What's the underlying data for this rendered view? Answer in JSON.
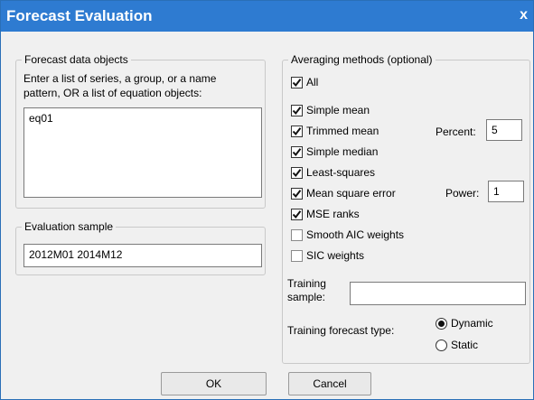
{
  "window": {
    "title": "Forecast Evaluation",
    "close_label": "x"
  },
  "forecast_objects": {
    "legend": "Forecast data objects",
    "instruction_line1": "Enter a list of series, a group, or a name",
    "instruction_line2": "pattern, OR a list of equation objects:",
    "value": "eq01"
  },
  "evaluation_sample": {
    "legend": "Evaluation sample",
    "value": "2012M01 2014M12"
  },
  "averaging": {
    "legend": "Averaging methods (optional)",
    "all": {
      "label": "All",
      "checked": true
    },
    "methods": [
      {
        "label": "Simple mean",
        "checked": true
      },
      {
        "label": "Trimmed mean",
        "checked": true
      },
      {
        "label": "Simple median",
        "checked": true
      },
      {
        "label": "Least-squares",
        "checked": true
      },
      {
        "label": "Mean square error",
        "checked": true
      },
      {
        "label": "MSE ranks",
        "checked": true
      },
      {
        "label": "Smooth AIC weights",
        "checked": false
      },
      {
        "label": "SIC weights",
        "checked": false
      }
    ],
    "percent_label": "Percent:",
    "percent_value": "5",
    "power_label": "Power:",
    "power_value": "1",
    "training_sample_label_line1": "Training",
    "training_sample_label_line2": "sample:",
    "training_sample_value": "",
    "training_forecast_type_label": "Training forecast type:",
    "forecast_types": [
      {
        "label": "Dynamic",
        "selected": true
      },
      {
        "label": "Static",
        "selected": false
      }
    ]
  },
  "buttons": {
    "ok": "OK",
    "cancel": "Cancel"
  }
}
